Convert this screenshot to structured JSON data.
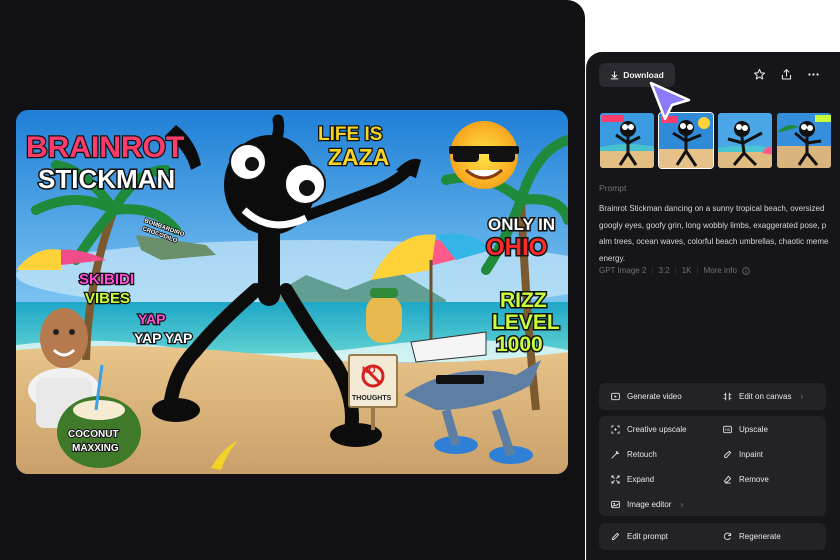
{
  "toolbar": {
    "download_label": "Download"
  },
  "prompt": {
    "label": "Prompt",
    "text": "Brainrot Stickman dancing on a sunny tropical beach, oversized googly eyes, goofy grin, long wobbly limbs, exaggerated pose, palm trees, ocean waves, colorful beach umbrellas, chaotic meme energy."
  },
  "meta": {
    "model": "GPT Image 2",
    "ratio": "3:2",
    "resolution": "1K",
    "more_info": "More info"
  },
  "actions": {
    "generate_video": "Generate video",
    "edit_on_canvas": "Edit on canvas",
    "creative_upscale": "Creative upscale",
    "upscale": "Upscale",
    "retouch": "Retouch",
    "inpaint": "Inpaint",
    "expand": "Expand",
    "remove": "Remove",
    "image_editor": "Image editor",
    "edit_prompt": "Edit prompt",
    "regenerate": "Regenerate"
  },
  "image_text": {
    "title_line1": "BRAINROT",
    "title_line2": "STICKMAN",
    "life_is": "LIFE IS",
    "zaza": "ZAZA",
    "only_in": "ONLY IN",
    "ohio": "OHIO",
    "skibidi": "SKIBIDI",
    "vibes": "VIBES",
    "yap1": "YAP",
    "yap2": "YAP YAP",
    "rizz": "RIZZ",
    "level": "LEVEL",
    "level_num": "1000",
    "no": "NO",
    "thoughts": "THOUGHTS",
    "coconut": "COCONUT",
    "maxxing": "MAXXING",
    "croc_line1": "BOMBARDIRO",
    "croc_line2": "CROCODILO"
  },
  "colors": {
    "accent_cursor": "#7b6cf6",
    "panel_dark": "#111113",
    "sidebar": "#16161a",
    "button_bg": "#222227"
  },
  "icons": [
    "download-icon",
    "star-icon",
    "share-icon",
    "more-icon",
    "info-icon",
    "video-icon",
    "canvas-edit-icon",
    "creative-upscale-icon",
    "upscale-icon",
    "retouch-icon",
    "inpaint-icon",
    "expand-icon",
    "remove-icon",
    "image-editor-icon",
    "edit-prompt-icon",
    "regenerate-icon"
  ]
}
